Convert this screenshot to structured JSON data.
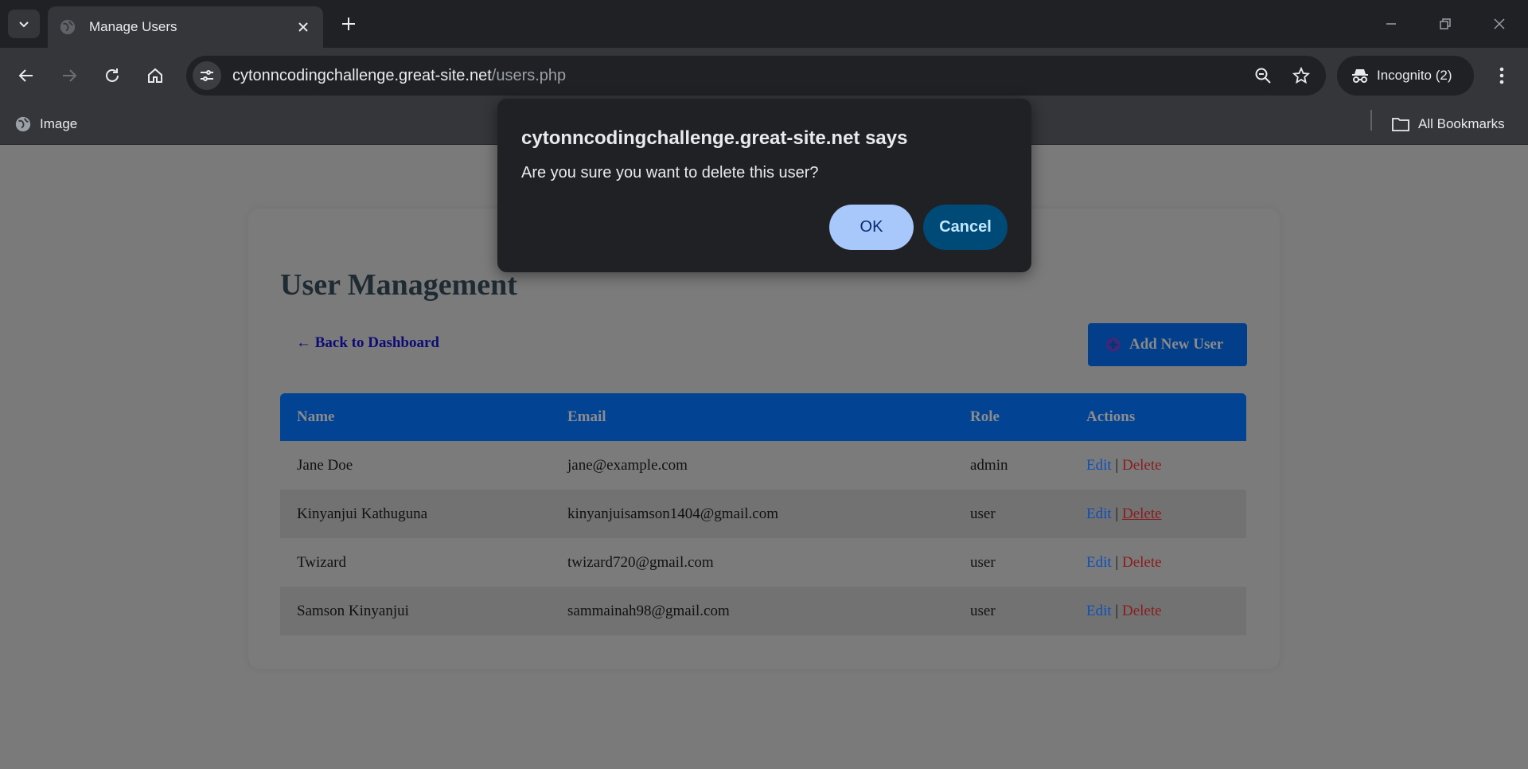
{
  "browser": {
    "tab_title": "Manage Users",
    "url_host": "cytonncodingchallenge.great-site.net",
    "url_path": "/users.php",
    "incognito_label": "Incognito (2)",
    "bookmarks": [
      {
        "label": "Image",
        "icon": "globe-icon"
      },
      {
        "label": "All Bookmarks",
        "icon": "folder-icon"
      }
    ]
  },
  "page": {
    "title": "User Management",
    "back_link": "← Back to Dashboard",
    "add_button": "Add New User",
    "table": {
      "headers": [
        "Name",
        "Email",
        "Role",
        "Actions"
      ],
      "rows": [
        {
          "name": "Jane Doe",
          "email": "jane@example.com",
          "role": "admin",
          "edit": "Edit",
          "sep": "|",
          "delete": "Delete"
        },
        {
          "name": "Kinyanjui Kathuguna",
          "email": "kinyanjuisamson1404@gmail.com",
          "role": "user",
          "edit": "Edit",
          "sep": "|",
          "delete": "Delete"
        },
        {
          "name": "Twizard",
          "email": "twizard720@gmail.com",
          "role": "user",
          "edit": "Edit",
          "sep": "|",
          "delete": "Delete"
        },
        {
          "name": "Samson Kinyanjui",
          "email": "sammainah98@gmail.com",
          "role": "user",
          "edit": "Edit",
          "sep": "|",
          "delete": "Delete"
        }
      ]
    }
  },
  "dialog": {
    "title": "cytonncodingchallenge.great-site.net says",
    "message": "Are you sure you want to delete this user?",
    "ok_label": "OK",
    "cancel_label": "Cancel"
  },
  "colors": {
    "chrome_dark": "#202124",
    "chrome_mid": "#35363a",
    "table_header": "#024394",
    "ok_button": "#a8c7fa",
    "cancel_button": "#004a77"
  }
}
